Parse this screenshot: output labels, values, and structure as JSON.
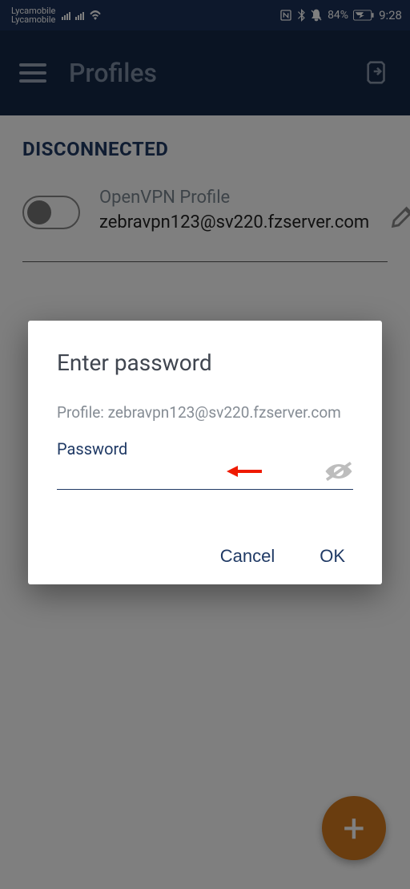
{
  "statusbar": {
    "carrier1": "Lycamobile",
    "carrier2": "Lycamobile",
    "battery": "84%",
    "time": "9:28"
  },
  "header": {
    "title": "Profiles"
  },
  "main": {
    "status": "DISCONNECTED",
    "profile_type": "OpenVPN Profile",
    "profile_name": "zebravpn123@sv220.fzserver.com"
  },
  "dialog": {
    "title": "Enter password",
    "subtitle": "Profile: zebravpn123@sv220.fzserver.com",
    "field_label": "Password",
    "field_value": "",
    "cancel": "Cancel",
    "ok": "OK"
  },
  "fab": {
    "label": "+"
  },
  "colors": {
    "accent": "#203a65",
    "fab": "#d47a1f"
  }
}
